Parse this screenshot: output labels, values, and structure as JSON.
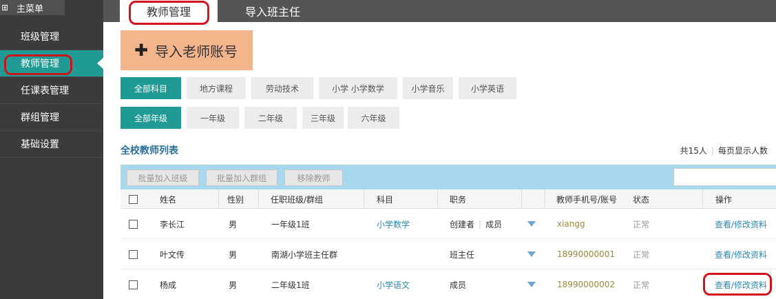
{
  "sidebar": {
    "header": "主菜单",
    "items": [
      {
        "label": "班级管理"
      },
      {
        "label": "教师管理"
      },
      {
        "label": "任课表管理"
      },
      {
        "label": "群组管理"
      },
      {
        "label": "基础设置"
      }
    ]
  },
  "tabs": [
    {
      "label": "教师管理"
    },
    {
      "label": "导入班主任"
    }
  ],
  "import_button": "导入老师账号",
  "subject_filters": [
    "全部科目",
    "地方课程",
    "劳动技术",
    "小学 小学数学",
    "小学音乐",
    "小学英语"
  ],
  "grade_filters": [
    "全部年级",
    "一年级",
    "二年级",
    "三年级",
    "六年级"
  ],
  "list": {
    "title": "全校教师列表",
    "total": "共15人",
    "per_page": "每页显示人数"
  },
  "toolbar": {
    "batch_class": "批量加入班级",
    "batch_group": "批量加入群组",
    "remove": "移除教师"
  },
  "table": {
    "headers": [
      "姓名",
      "性别",
      "任职班级/群组",
      "科目",
      "职务",
      "教师手机号/账号",
      "状态",
      "操作"
    ],
    "rows": [
      {
        "name": "李长江",
        "gender": "男",
        "class": "一年级1班",
        "subject": "小学数学",
        "role1": "创建者",
        "role2": "成员",
        "account": "xiangg",
        "status": "正常",
        "action": "查看/修改资料"
      },
      {
        "name": "叶文传",
        "gender": "男",
        "class": "南湖小学班主任群",
        "subject": "",
        "role1": "班主任",
        "role2": "",
        "account": "18990000001",
        "status": "正常",
        "action": "查看/修改资料"
      },
      {
        "name": "杨成",
        "gender": "男",
        "class": "二年级1班",
        "subject": "小学语文",
        "role1": "成员",
        "role2": "",
        "account": "18990000002",
        "status": "正常",
        "action": "查看/修改资料"
      }
    ]
  },
  "colors": {
    "accent": "#1f9a94",
    "sidebar_bg": "#3b3b3b",
    "annotation_red": "#d0121b",
    "import_button_bg": "#f4b48c",
    "toolbar_bg": "#a8d8ee"
  }
}
